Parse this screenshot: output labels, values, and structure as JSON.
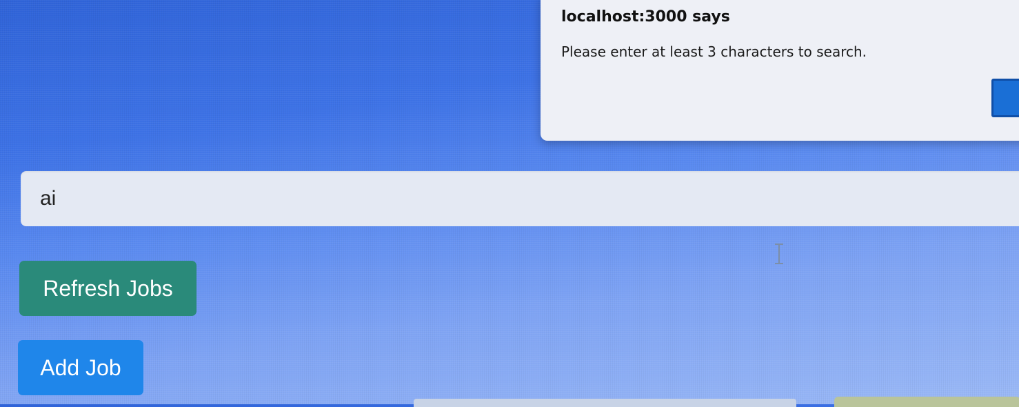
{
  "alert": {
    "title": "localhost:3000 says",
    "message": "Please enter at least 3 characters to search."
  },
  "search": {
    "value": "ai"
  },
  "buttons": {
    "refresh_label": "Refresh Jobs",
    "add_job_label": "Add Job"
  },
  "colors": {
    "refresh_button": "#2a8a7a",
    "add_job_button": "#1f86ea",
    "alert_ok_button": "#1a6fd6",
    "background_top": "#2f63d8",
    "background_bottom": "#9bb9f6"
  },
  "icons": {
    "cursor": "text-cursor-ibeam-icon"
  }
}
